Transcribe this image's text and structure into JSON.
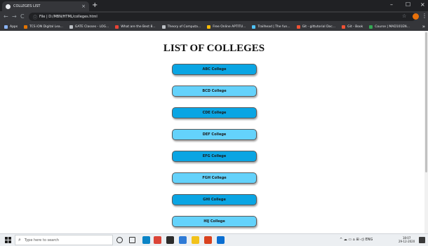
{
  "browser": {
    "tab_title": "COLLEGES LIST",
    "tab_close": "×",
    "new_tab": "+",
    "window_controls": {
      "minimize": "–",
      "maximize": "☐",
      "close": "×"
    },
    "nav": {
      "back": "←",
      "forward": "→",
      "reload": "C"
    },
    "address_info": "ⓘ",
    "address_url": "File | D:/MBN/HTML/colleges.html",
    "star": "☆",
    "menu": "⋮",
    "bookmarks": [
      {
        "label": "Apps",
        "color": "#8ab4f8"
      },
      {
        "label": "TCS iON Digital Lea...",
        "color": "#e37400"
      },
      {
        "label": "GATE Classes - LOG...",
        "color": "#bdc1c6"
      },
      {
        "label": "What are the Best 8...",
        "color": "#ea4335"
      },
      {
        "label": "Theory of Computa...",
        "color": "#bdc1c6"
      },
      {
        "label": "Free Online APTITU...",
        "color": "#fbbc04"
      },
      {
        "label": "Trailhead | The fun...",
        "color": "#4fc3f7"
      },
      {
        "label": "Git - gittutorial Doc...",
        "color": "#f05133"
      },
      {
        "label": "Git - Book",
        "color": "#f05133"
      },
      {
        "label": "Course | MAD101EN...",
        "color": "#34a853"
      }
    ],
    "bookmarks_more": "»"
  },
  "page": {
    "heading": "LIST OF COLLEGES",
    "colleges": [
      {
        "label": "ABC College",
        "style": "dark"
      },
      {
        "label": "BCD College",
        "style": "light"
      },
      {
        "label": "CDE College",
        "style": "dark"
      },
      {
        "label": "DEF College",
        "style": "light"
      },
      {
        "label": "EFG College",
        "style": "dark"
      },
      {
        "label": "FGH College",
        "style": "light"
      },
      {
        "label": "GHI College",
        "style": "dark"
      },
      {
        "label": "HIJ College",
        "style": "light"
      }
    ]
  },
  "taskbar": {
    "search_placeholder": "Type here to search",
    "search_icon": "⌕",
    "apps": [
      {
        "name": "cortana-icon",
        "color": "#333333"
      },
      {
        "name": "task-view-icon",
        "color": "#333333"
      },
      {
        "name": "edge-icon",
        "color": "#0a84c6"
      },
      {
        "name": "chrome-icon",
        "color": "#db4437"
      },
      {
        "name": "store-icon",
        "color": "#2b2b2b"
      },
      {
        "name": "mail-icon",
        "color": "#2f7bd6"
      },
      {
        "name": "file-explorer-icon",
        "color": "#f2c21b"
      },
      {
        "name": "app-icon",
        "color": "#d9421f"
      },
      {
        "name": "outlook-icon",
        "color": "#0a6ed1"
      }
    ],
    "tray": "^ ☁ ▭ ⌂ ⊞ ◁) ENG",
    "time": "18:07",
    "date": "29-12-2020"
  }
}
